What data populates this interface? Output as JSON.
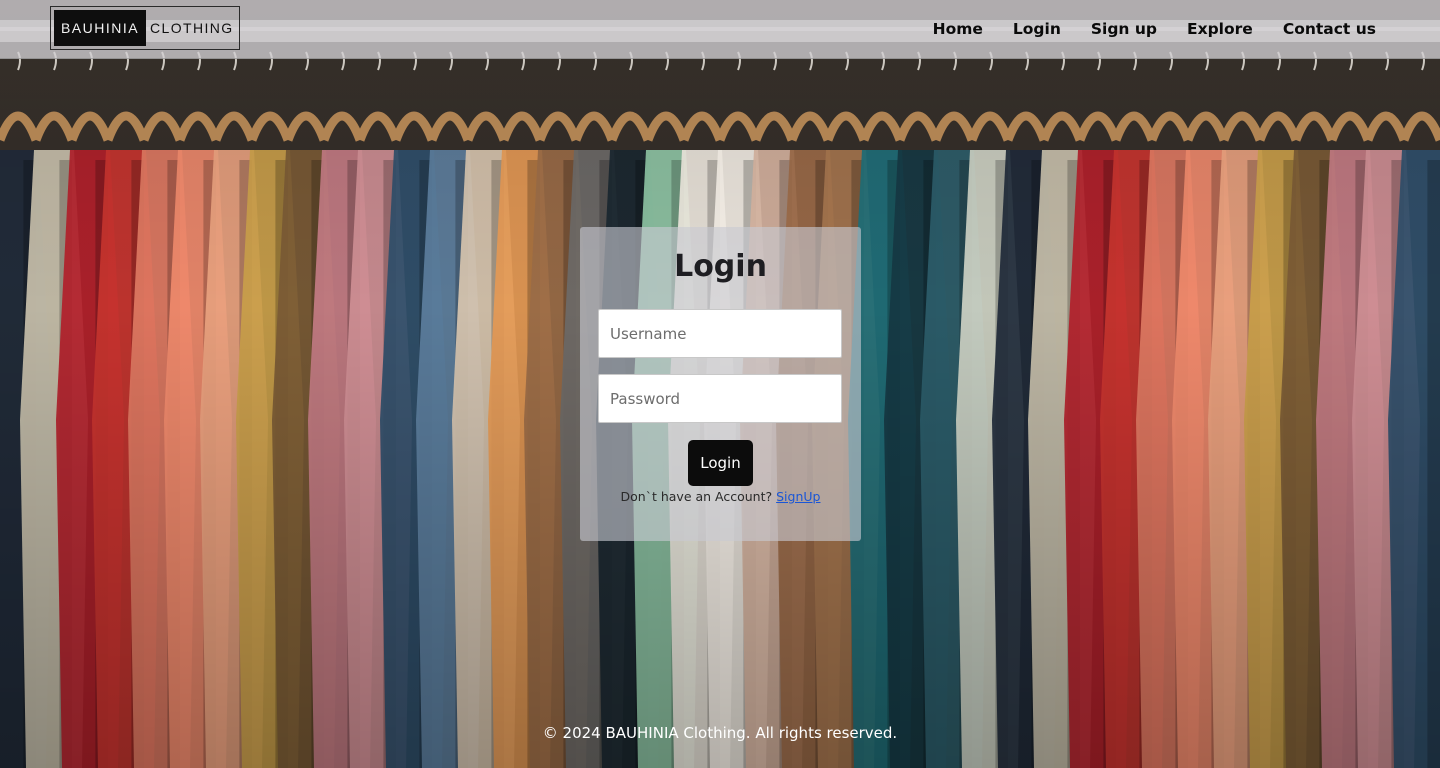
{
  "brand": {
    "dark_text": "BAUHINIA",
    "light_text": "CLOTHING"
  },
  "nav": {
    "items": [
      {
        "label": "Home"
      },
      {
        "label": "Login"
      },
      {
        "label": "Sign up"
      },
      {
        "label": "Explore"
      },
      {
        "label": "Contact us"
      }
    ]
  },
  "login_card": {
    "title": "Login",
    "username_placeholder": "Username",
    "password_placeholder": "Password",
    "button_label": "Login",
    "signup_prompt": "Don`t have an Account?",
    "signup_link": "SignUp"
  },
  "footer": {
    "text": "© 2024 BAUHINIA Clothing. All rights reserved."
  },
  "colors": {
    "navbar_bg": "#d2d0d4",
    "button_bg": "#0c0c0c",
    "link": "#1a56d6"
  }
}
